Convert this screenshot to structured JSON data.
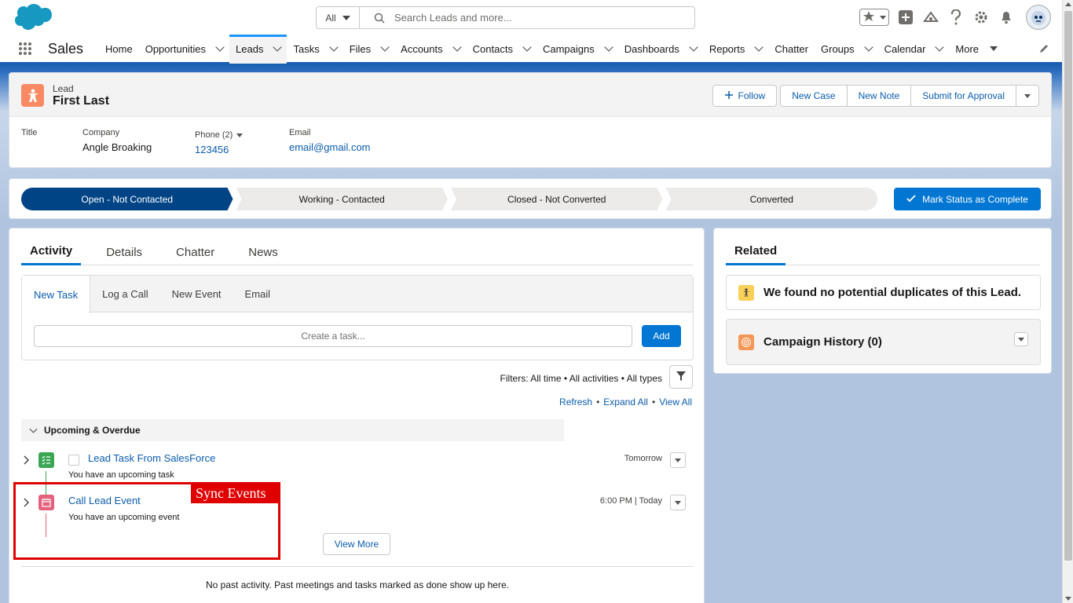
{
  "header": {
    "search_scope": "All",
    "search_placeholder": "Search Leads and more...",
    "app_name": "Sales"
  },
  "nav": {
    "items": [
      {
        "label": "Home",
        "dropdown": false
      },
      {
        "label": "Opportunities",
        "dropdown": true
      },
      {
        "label": "Leads",
        "dropdown": true,
        "active": true
      },
      {
        "label": "Tasks",
        "dropdown": true
      },
      {
        "label": "Files",
        "dropdown": true
      },
      {
        "label": "Accounts",
        "dropdown": true
      },
      {
        "label": "Contacts",
        "dropdown": true
      },
      {
        "label": "Campaigns",
        "dropdown": true
      },
      {
        "label": "Dashboards",
        "dropdown": true
      },
      {
        "label": "Reports",
        "dropdown": true
      },
      {
        "label": "Chatter",
        "dropdown": false
      },
      {
        "label": "Groups",
        "dropdown": true
      },
      {
        "label": "Calendar",
        "dropdown": true
      },
      {
        "label": "More",
        "dropdown": true
      }
    ]
  },
  "record": {
    "object_label": "Lead",
    "name": "First Last",
    "buttons": {
      "follow": "Follow",
      "new_case": "New Case",
      "new_note": "New Note",
      "submit": "Submit for Approval"
    },
    "fields": {
      "title_label": "Title",
      "company_label": "Company",
      "company_value": "Angle Broaking",
      "phone_label": "Phone (2)",
      "phone_value": "123456",
      "email_label": "Email",
      "email_value": "email@gmail.com"
    }
  },
  "path": {
    "stages": [
      "Open - Not Contacted",
      "Working - Contacted",
      "Closed - Not Converted",
      "Converted"
    ],
    "mark_button": "Mark Status as Complete"
  },
  "activity": {
    "tabs": [
      "Activity",
      "Details",
      "Chatter",
      "News"
    ],
    "composer_tabs": [
      "New Task",
      "Log a Call",
      "New Event",
      "Email"
    ],
    "task_placeholder": "Create a task...",
    "add_label": "Add",
    "filters_text": "Filters: All time • All activities • All types",
    "links": {
      "refresh": "Refresh",
      "expand_all": "Expand All",
      "view_all": "View All"
    },
    "section_title": "Upcoming & Overdue",
    "items": [
      {
        "title": "Lead Task From SalesForce",
        "subtitle": "You have an upcoming task",
        "date": "Tomorrow",
        "type": "task",
        "color": "#3ba755"
      },
      {
        "title": "Call Lead Event",
        "subtitle": "You have an upcoming event",
        "date": "6:00 PM | Today",
        "type": "event",
        "color": "#e3627e"
      }
    ],
    "view_more": "View More",
    "no_past": "No past activity. Past meetings and tasks marked as done show up here."
  },
  "annotation": {
    "label": "Sync Events",
    "color": "#e00000"
  },
  "related": {
    "tab": "Related",
    "duplicates": "We found no potential duplicates of this Lead.",
    "campaign_history": "Campaign History (0)"
  },
  "colors": {
    "brand": "#0176d3",
    "path_current": "#014486",
    "lead_icon": "#f88962"
  }
}
